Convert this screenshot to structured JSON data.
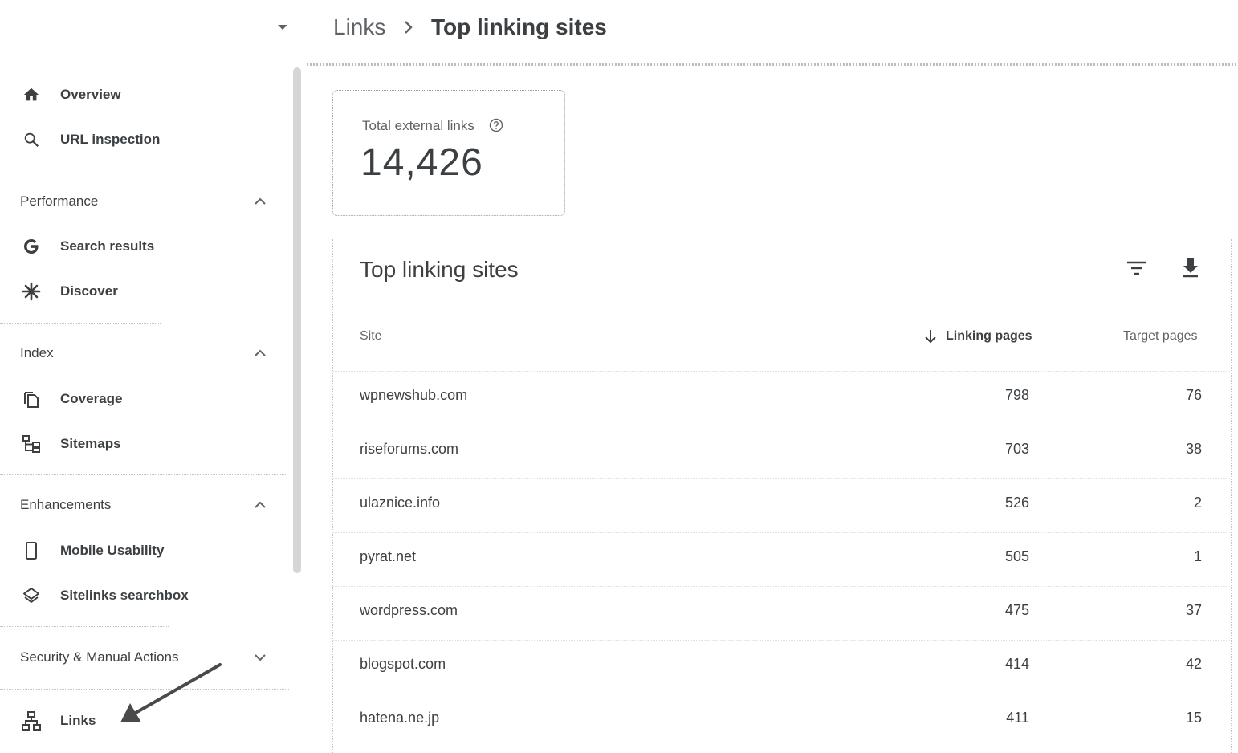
{
  "header": {
    "breadcrumb_root": "Links",
    "page_title": "Top linking sites"
  },
  "sidebar": {
    "top_items": [
      {
        "label": "Overview",
        "icon": "home-icon"
      },
      {
        "label": "URL inspection",
        "icon": "search-icon"
      }
    ],
    "sections": [
      {
        "title": "Performance",
        "expanded": true,
        "items": [
          {
            "label": "Search results",
            "icon": "google-g-icon"
          },
          {
            "label": "Discover",
            "icon": "asterisk-icon"
          }
        ]
      },
      {
        "title": "Index",
        "expanded": true,
        "items": [
          {
            "label": "Coverage",
            "icon": "copy-pages-icon"
          },
          {
            "label": "Sitemaps",
            "icon": "sitemap-icon"
          }
        ]
      },
      {
        "title": "Enhancements",
        "expanded": true,
        "items": [
          {
            "label": "Mobile Usability",
            "icon": "phone-icon"
          },
          {
            "label": "Sitelinks searchbox",
            "icon": "layers-icon"
          }
        ]
      },
      {
        "title": "Security & Manual Actions",
        "expanded": false,
        "items": []
      }
    ],
    "bottom_item": {
      "label": "Links",
      "icon": "links-network-icon"
    }
  },
  "stat": {
    "label": "Total external links",
    "value": "14,426"
  },
  "table": {
    "title": "Top linking sites",
    "columns": {
      "site": "Site",
      "linking": "Linking pages",
      "target": "Target pages"
    },
    "rows": [
      {
        "site": "wpnewshub.com",
        "linking": "798",
        "target": "76"
      },
      {
        "site": "riseforums.com",
        "linking": "703",
        "target": "38"
      },
      {
        "site": "ulaznice.info",
        "linking": "526",
        "target": "2"
      },
      {
        "site": "pyrat.net",
        "linking": "505",
        "target": "1"
      },
      {
        "site": "wordpress.com",
        "linking": "475",
        "target": "37"
      },
      {
        "site": "blogspot.com",
        "linking": "414",
        "target": "42"
      },
      {
        "site": "hatena.ne.jp",
        "linking": "411",
        "target": "15"
      }
    ]
  },
  "colors": {
    "text": "#3c4043",
    "muted": "#5f6368",
    "annotation_arrow": "#4a4a4a"
  }
}
